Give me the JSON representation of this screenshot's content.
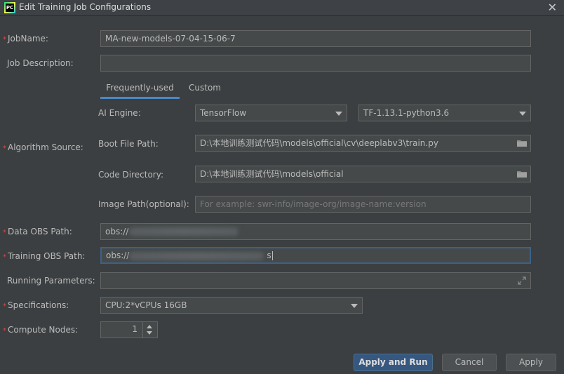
{
  "window": {
    "title": "Edit Training Job Configurations",
    "app_badge": "PC"
  },
  "labels": {
    "job_name": "JobName:",
    "job_description": "Job Description:",
    "ai_engine": "AI Engine:",
    "algorithm_source": "Algorithm Source:",
    "boot_file_path": "Boot File Path:",
    "code_directory": "Code Directory:",
    "image_path": "Image Path(optional):",
    "data_obs_path": "Data OBS Path:",
    "training_obs_path": "Training OBS Path:",
    "running_parameters": "Running Parameters:",
    "specifications": "Specifications:",
    "compute_nodes": "Compute Nodes:"
  },
  "required_marker": "*",
  "tabs": [
    {
      "label": "Frequently-used",
      "active": true
    },
    {
      "label": "Custom",
      "active": false
    }
  ],
  "fields": {
    "job_name": "MA-new-models-07-04-15-06-7",
    "job_description": "",
    "ai_engine": "TensorFlow",
    "engine_version": "TF-1.13.1-python3.6",
    "boot_file_path": "D:\\本地训练测试代码\\models\\official\\cv\\deeplabv3\\train.py",
    "code_directory": "D:\\本地训练测试代码\\models\\official",
    "image_path_placeholder": "For example: swr-info/image-org/image-name:version",
    "data_obs_path": "obs://",
    "training_obs_path_prefix": "obs://",
    "training_obs_path_suffix": "s",
    "specifications": "CPU:2*vCPUs 16GB",
    "compute_nodes": "1"
  },
  "buttons": {
    "apply_run": "Apply and Run",
    "cancel": "Cancel",
    "apply": "Apply"
  },
  "colors": {
    "accent": "#4a88c7",
    "required": "#e0453e",
    "primary_button": "#365880"
  },
  "icons": [
    "close-icon",
    "folder-icon",
    "expand-icon",
    "chevron-down-icon",
    "chevron-up-icon"
  ]
}
